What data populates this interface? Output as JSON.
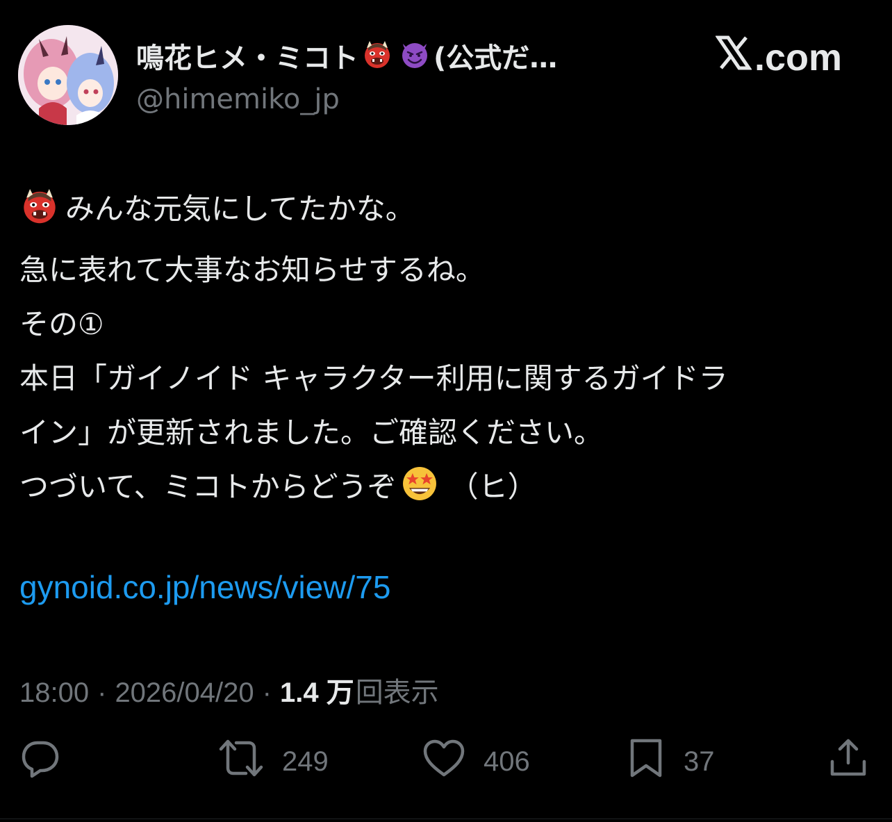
{
  "author": {
    "display_name": "鳴花ヒメ・ミコト",
    "display_name_suffix": "(公式だ…",
    "handle": "@himemiko_jp",
    "avatar_icon": "anime-avatar-icon",
    "name_emojis": [
      "red-oni-emoji",
      "smiling-devil-emoji"
    ]
  },
  "brand": {
    "label": ".com",
    "logo_icon": "x-logo-icon"
  },
  "post": {
    "lines": [
      "みんな元気にしてたかな。",
      "急に表れて大事なお知らせするね。",
      "その①",
      "本日「ガイノイド キャラクター利用に関するガイドラ",
      "イン」が更新されました。ご確認ください。",
      "つづいて、ミコトからどうぞ",
      "（ヒ）"
    ],
    "first_line_emoji": "red-oni-emoji",
    "star_emoji": "star-struck-emoji",
    "link": "gynoid.co.jp/news/view/75"
  },
  "meta": {
    "time": "18:00",
    "date": "2026/04/20",
    "views_count": "1.4 万",
    "views_label": "回表示",
    "separator": "·"
  },
  "actions": {
    "reply": {
      "icon": "reply-icon",
      "count": ""
    },
    "repost": {
      "icon": "repost-icon",
      "count": "249"
    },
    "like": {
      "icon": "heart-icon",
      "count": "406"
    },
    "bookmark": {
      "icon": "bookmark-icon",
      "count": "37"
    },
    "share": {
      "icon": "share-icon",
      "count": ""
    }
  },
  "colors": {
    "background": "#000000",
    "text": "#e7e9ea",
    "muted": "#71767b",
    "link": "#1d9bf0"
  }
}
